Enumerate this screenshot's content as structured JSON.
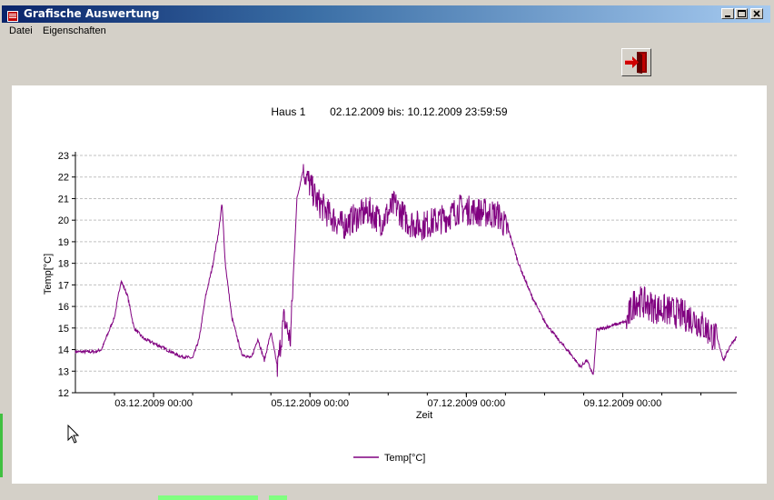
{
  "window": {
    "title": "Grafische Auswertung",
    "accent": "#0a246a"
  },
  "menu": {
    "items": [
      "Datei",
      "Eigenschaften"
    ]
  },
  "toolbar": {
    "exit_icon": "exit-door-icon"
  },
  "chart_header": {
    "name": "Haus 1",
    "range": "02.12.2009 bis: 10.12.2009 23:59:59"
  },
  "chart_data": {
    "type": "line",
    "xlabel": "Zeit",
    "ylabel": "Temp[°C]",
    "ylim": [
      12,
      23
    ],
    "yticks": [
      "12",
      "13",
      "14",
      "15",
      "16",
      "17",
      "18",
      "19",
      "20",
      "21",
      "22",
      "23"
    ],
    "xlim": [
      "2009-12-02 00:00",
      "2009-12-10 11:00"
    ],
    "xtick_labels": [
      "03.12.2009 00:00",
      "05.12.2009 00:00",
      "07.12.2009 00:00",
      "09.12.2009 00:00"
    ],
    "grid": true,
    "legend_position": "bottom",
    "series": [
      {
        "name": "Temp[°C]",
        "color": "#800080",
        "points": [
          [
            "2009-12-02 00:00",
            13.9
          ],
          [
            "2009-12-02 06:00",
            13.9
          ],
          [
            "2009-12-02 08:00",
            14.0
          ],
          [
            "2009-12-02 12:00",
            15.5
          ],
          [
            "2009-12-02 14:00",
            17.2
          ],
          [
            "2009-12-02 16:00",
            16.5
          ],
          [
            "2009-12-02 18:00",
            15.0
          ],
          [
            "2009-12-02 21:00",
            14.5
          ],
          [
            "2009-12-03 00:00",
            14.3
          ],
          [
            "2009-12-03 04:00",
            14.0
          ],
          [
            "2009-12-03 08:00",
            13.7
          ],
          [
            "2009-12-03 12:00",
            13.6
          ],
          [
            "2009-12-03 14:00",
            14.5
          ],
          [
            "2009-12-03 16:00",
            16.5
          ],
          [
            "2009-12-03 18:00",
            17.8
          ],
          [
            "2009-12-03 20:00",
            19.5
          ],
          [
            "2009-12-03 21:00",
            20.8
          ],
          [
            "2009-12-03 22:00",
            18.0
          ],
          [
            "2009-12-04 00:00",
            15.5
          ],
          [
            "2009-12-04 03:00",
            13.8
          ],
          [
            "2009-12-04 06:00",
            13.6
          ],
          [
            "2009-12-04 08:00",
            14.5
          ],
          [
            "2009-12-04 10:00",
            13.5
          ],
          [
            "2009-12-04 12:00",
            14.8
          ],
          [
            "2009-12-04 14:00",
            13.2
          ],
          [
            "2009-12-04 16:00",
            15.5
          ],
          [
            "2009-12-04 18:00",
            14.5
          ],
          [
            "2009-12-04 20:00",
            21.0
          ],
          [
            "2009-12-04 22:00",
            22.4
          ],
          [
            "2009-12-05 02:00",
            21.0
          ],
          [
            "2009-12-05 06:00",
            20.3
          ],
          [
            "2009-12-05 10:00",
            19.8
          ],
          [
            "2009-12-05 14:00",
            20.2
          ],
          [
            "2009-12-05 18:00",
            20.5
          ],
          [
            "2009-12-05 22:00",
            20.0
          ],
          [
            "2009-12-06 02:00",
            20.8
          ],
          [
            "2009-12-06 06:00",
            20.0
          ],
          [
            "2009-12-06 10:00",
            19.8
          ],
          [
            "2009-12-06 14:00",
            20.0
          ],
          [
            "2009-12-06 18:00",
            20.2
          ],
          [
            "2009-12-06 22:00",
            20.6
          ],
          [
            "2009-12-07 02:00",
            20.5
          ],
          [
            "2009-12-07 06:00",
            20.4
          ],
          [
            "2009-12-07 10:00",
            20.3
          ],
          [
            "2009-12-07 13:00",
            19.5
          ],
          [
            "2009-12-07 16:00",
            18.0
          ],
          [
            "2009-12-07 20:00",
            16.5
          ],
          [
            "2009-12-08 00:00",
            15.3
          ],
          [
            "2009-12-08 04:00",
            14.5
          ],
          [
            "2009-12-08 08:00",
            13.8
          ],
          [
            "2009-12-08 11:00",
            13.2
          ],
          [
            "2009-12-08 13:00",
            13.5
          ],
          [
            "2009-12-08 15:00",
            12.8
          ],
          [
            "2009-12-08 16:00",
            14.9
          ],
          [
            "2009-12-09 01:00",
            15.3
          ],
          [
            "2009-12-09 04:00",
            16.4
          ],
          [
            "2009-12-09 10:00",
            16.0
          ],
          [
            "2009-12-09 16:00",
            15.8
          ],
          [
            "2009-12-09 22:00",
            15.5
          ],
          [
            "2009-12-10 02:00",
            15.0
          ],
          [
            "2009-12-10 05:00",
            14.5
          ],
          [
            "2009-12-10 07:00",
            13.5
          ],
          [
            "2009-12-10 09:00",
            14.2
          ],
          [
            "2009-12-10 11:00",
            14.6
          ]
        ],
        "noise_bands": [
          {
            "from": "2009-12-04 14:00",
            "to": "2009-12-04 19:00",
            "amplitude": 1.2
          },
          {
            "from": "2009-12-04 22:00",
            "to": "2009-12-07 13:00",
            "amplitude": 1.4
          },
          {
            "from": "2009-12-09 01:00",
            "to": "2009-12-10 05:00",
            "amplitude": 1.5
          }
        ]
      }
    ]
  }
}
